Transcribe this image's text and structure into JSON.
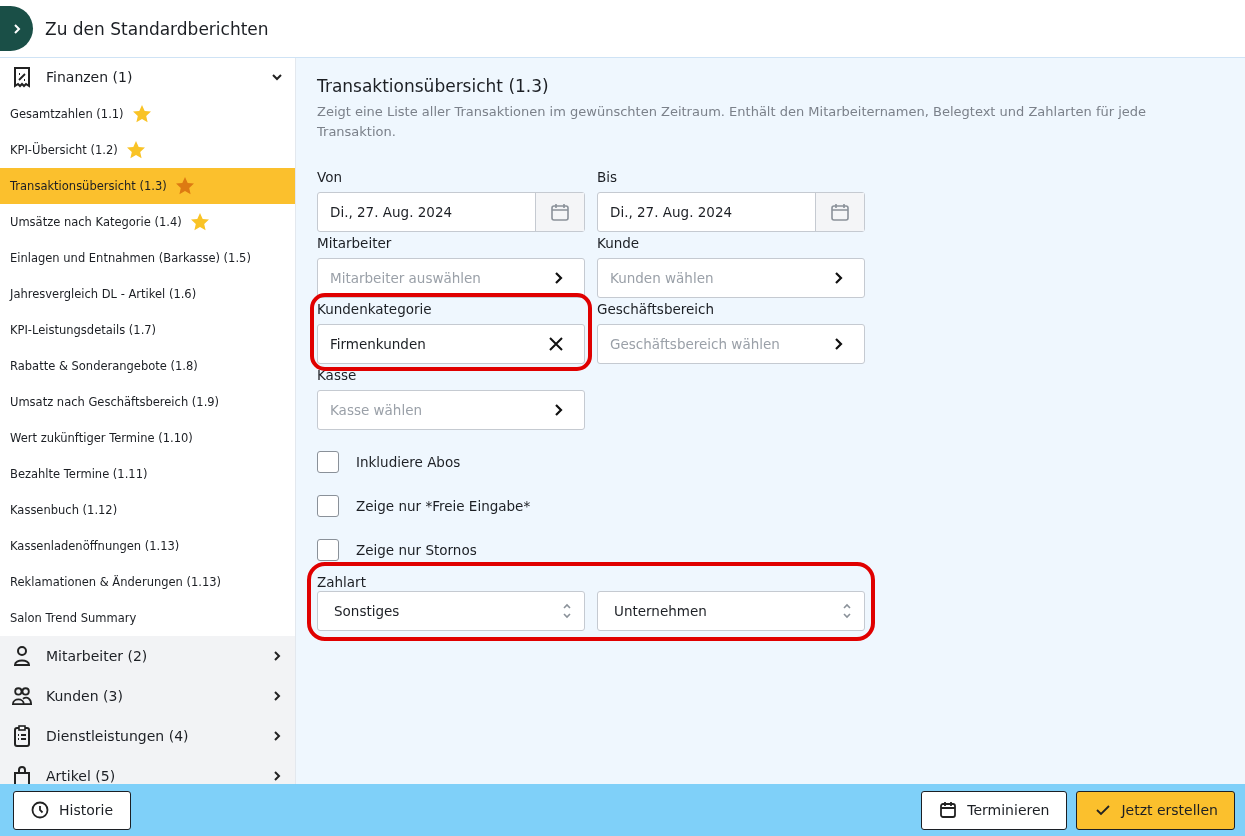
{
  "header": {
    "title": "Zu den Standardberichten"
  },
  "sidebar": {
    "sections": [
      {
        "title": "Finanzen (1)",
        "expanded": true,
        "items": [
          {
            "label": "Gesamtzahlen (1.1)",
            "selected": false,
            "starred": true
          },
          {
            "label": "KPI-Übersicht (1.2)",
            "selected": false,
            "starred": true
          },
          {
            "label": "Transaktionsübersicht (1.3)",
            "selected": true,
            "starred": true
          },
          {
            "label": "Umsätze nach Kategorie (1.4)",
            "selected": false,
            "starred": true
          },
          {
            "label": "Einlagen und Entnahmen (Barkasse) (1.5)",
            "selected": false,
            "starred": false
          },
          {
            "label": "Jahresvergleich DL - Artikel (1.6)",
            "selected": false,
            "starred": false
          },
          {
            "label": "KPI-Leistungsdetails (1.7)",
            "selected": false,
            "starred": false
          },
          {
            "label": "Rabatte & Sonderangebote (1.8)",
            "selected": false,
            "starred": false
          },
          {
            "label": "Umsatz nach Geschäftsbereich (1.9)",
            "selected": false,
            "starred": false
          },
          {
            "label": "Wert zukünftiger Termine (1.10)",
            "selected": false,
            "starred": false
          },
          {
            "label": "Bezahlte Termine (1.11)",
            "selected": false,
            "starred": false
          },
          {
            "label": "Kassenbuch (1.12)",
            "selected": false,
            "starred": false
          },
          {
            "label": "Kassenladenöffnungen (1.13)",
            "selected": false,
            "starred": false
          },
          {
            "label": "Reklamationen & Änderungen (1.13)",
            "selected": false,
            "starred": false
          },
          {
            "label": "Salon Trend Summary",
            "selected": false,
            "starred": false
          }
        ]
      },
      {
        "title": "Mitarbeiter (2)",
        "expanded": false
      },
      {
        "title": "Kunden (3)",
        "expanded": false
      },
      {
        "title": "Dienstleistungen (4)",
        "expanded": false
      },
      {
        "title": "Artikel (5)",
        "expanded": false
      }
    ]
  },
  "report": {
    "title": "Transaktionsübersicht (1.3)",
    "description": "Zeigt eine Liste aller Transaktionen im gewünschten Zeitraum. Enthält den Mitarbeiternamen, Belegtext und Zahlarten für jede Transaktion."
  },
  "fields": [
    {
      "label": "Von",
      "kind": "date",
      "value": "Di., 27. Aug. 2024",
      "highlighted": false
    },
    {
      "label": "Bis",
      "kind": "date",
      "value": "Di., 27. Aug. 2024",
      "highlighted": false
    },
    {
      "label": "Mitarbeiter",
      "kind": "picker",
      "placeholder": "Mitarbeiter auswählen",
      "highlighted": false
    },
    {
      "label": "Kunde",
      "kind": "picker",
      "placeholder": "Kunden wählen",
      "highlighted": false
    },
    {
      "label": "Kundenkategorie",
      "kind": "clearable",
      "value": "Firmenkunden",
      "highlighted": true
    },
    {
      "label": "Geschäftsbereich",
      "kind": "picker",
      "placeholder": "Geschäftsbereich wählen",
      "highlighted": false
    },
    {
      "label": "Kasse",
      "kind": "picker",
      "placeholder": "Kasse wählen",
      "highlighted": false
    }
  ],
  "checkboxes": [
    {
      "label": "Inkludiere Abos",
      "checked": false
    },
    {
      "label": "Zeige nur *Freie Eingabe*",
      "checked": false
    },
    {
      "label": "Zeige nur Stornos",
      "checked": false
    }
  ],
  "payment": {
    "label": "Zahlart",
    "highlighted": true,
    "selects": [
      {
        "value": "Sonstiges"
      },
      {
        "value": "Unternehmen"
      }
    ]
  },
  "footer": {
    "buttons": [
      {
        "label": "Historie",
        "kind": "history"
      },
      {
        "label": "Terminieren",
        "kind": "schedule"
      },
      {
        "label": "Jetzt erstellen",
        "kind": "primary"
      }
    ]
  }
}
